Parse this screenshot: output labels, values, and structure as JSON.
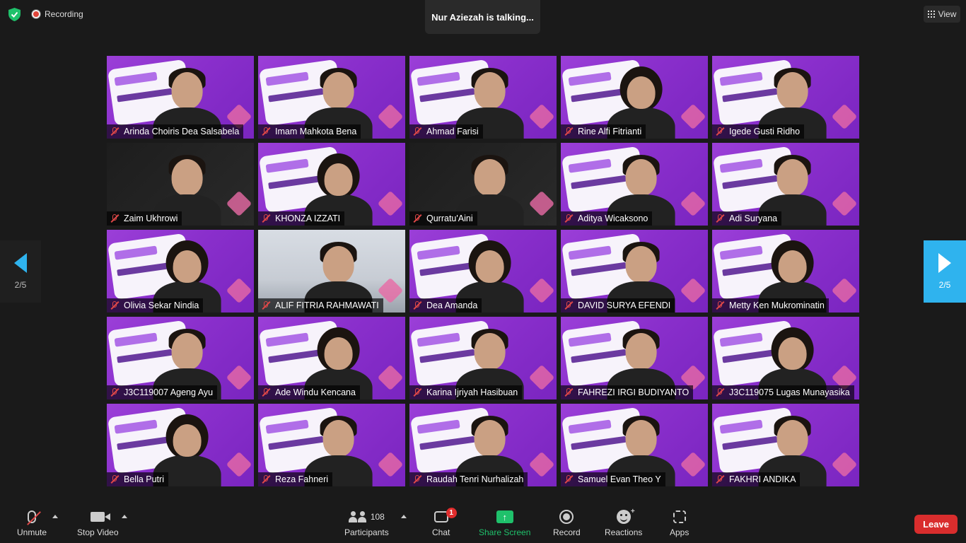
{
  "top": {
    "recording_label": "Recording",
    "talking": "Nur Aziezah is talking...",
    "view_label": "View"
  },
  "pager": {
    "left_label": "2/5",
    "right_label": "2/5"
  },
  "participants": [
    {
      "name": "Arinda Choiris Dea Salsabela"
    },
    {
      "name": "Imam Mahkota Bena"
    },
    {
      "name": "Ahmad Farisi"
    },
    {
      "name": "Rine Alfi Fitrianti"
    },
    {
      "name": "Igede Gusti Ridho"
    },
    {
      "name": "Zaim Ukhrowi"
    },
    {
      "name": "KHONZA IZZATI"
    },
    {
      "name": "Qurratu'Aini"
    },
    {
      "name": "Aditya Wicaksono"
    },
    {
      "name": "Adi Suryana"
    },
    {
      "name": "Olivia Sekar Nindia"
    },
    {
      "name": "ALIF FITRIA RAHMAWATI"
    },
    {
      "name": "Dea Amanda"
    },
    {
      "name": "DAVID SURYA EFENDI"
    },
    {
      "name": "Metty Ken Mukrominatin"
    },
    {
      "name": "J3C119007 Ageng Ayu"
    },
    {
      "name": "Ade Windu Kencana"
    },
    {
      "name": "Karina Ijriyah Hasibuan"
    },
    {
      "name": "FAHREZI IRGI BUDIYANTO"
    },
    {
      "name": "J3C119075 Lugas Munayasika"
    },
    {
      "name": "Bella Putri"
    },
    {
      "name": "Reza Fahneri"
    },
    {
      "name": "Raudah Tenri Nurhalizah"
    },
    {
      "name": "Samuel Evan Theo Y"
    },
    {
      "name": "FAKHRI ANDIKA"
    }
  ],
  "toolbar": {
    "unmute_label": "Unmute",
    "stop_video_label": "Stop Video",
    "participants_label": "Participants",
    "participants_count": "108",
    "chat_label": "Chat",
    "chat_badge": "1",
    "share_label": "Share Screen",
    "record_label": "Record",
    "reactions_label": "Reactions",
    "apps_label": "Apps",
    "leave_label": "Leave"
  },
  "colors": {
    "share_accent": "#1fc16b",
    "leave": "#d92d2d",
    "pager_active": "#2fb3ee",
    "tile_bg": "#8a2fcc"
  }
}
